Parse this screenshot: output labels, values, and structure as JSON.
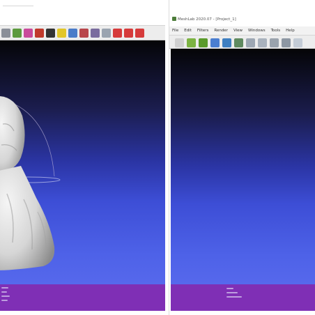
{
  "right_window": {
    "title": "MeshLab 2020.07 - [Project_1]",
    "menu": [
      "File",
      "Edit",
      "Filters",
      "Render",
      "View",
      "Windows",
      "Tools",
      "Help"
    ]
  },
  "left_toolbar": {
    "icons": [
      {
        "name": "layer-icon",
        "color": "#8a8f98"
      },
      {
        "name": "cube-icon",
        "color": "#5c9a3e"
      },
      {
        "name": "palette-icon",
        "color": "#c94a9b"
      },
      {
        "name": "bookmark-icon",
        "color": "#c0392b"
      },
      {
        "name": "light-icon",
        "color": "#333333"
      },
      {
        "name": "measure-icon",
        "color": "#e2c62a"
      },
      {
        "name": "pick-icon",
        "color": "#4a7cc9"
      },
      {
        "name": "paint-icon",
        "color": "#b8464b"
      },
      {
        "name": "select-icon",
        "color": "#7a6c9e"
      },
      {
        "name": "zoom-icon",
        "color": "#9aa4b0"
      },
      {
        "name": "delete-faces-icon",
        "color": "#d63b3b"
      },
      {
        "name": "delete-vertices-icon",
        "color": "#d63b3b"
      },
      {
        "name": "delete-all-icon",
        "color": "#d63b3b"
      }
    ]
  },
  "right_toolbar": {
    "icons": [
      {
        "name": "new-icon",
        "color": "#d0d0d0"
      },
      {
        "name": "open-icon",
        "color": "#7cb342"
      },
      {
        "name": "import-icon",
        "color": "#5a9a2a"
      },
      {
        "name": "reload-icon",
        "color": "#4a7ed0"
      },
      {
        "name": "export-icon",
        "color": "#3e7fc1"
      },
      {
        "name": "snapshot-icon",
        "color": "#5f8a5f"
      },
      {
        "name": "layers-icon",
        "color": "#9da7b3"
      },
      {
        "name": "points-icon",
        "color": "#a9b2bd"
      },
      {
        "name": "wireframe-icon",
        "color": "#9aa3ad"
      },
      {
        "name": "flat-icon",
        "color": "#8d97a3"
      },
      {
        "name": "smooth-icon",
        "color": "#c4ccd6"
      }
    ]
  },
  "colors": {
    "viewport_top": "#050507",
    "viewport_bottom": "#5668ec",
    "status_bar": "#7f2fb5"
  }
}
